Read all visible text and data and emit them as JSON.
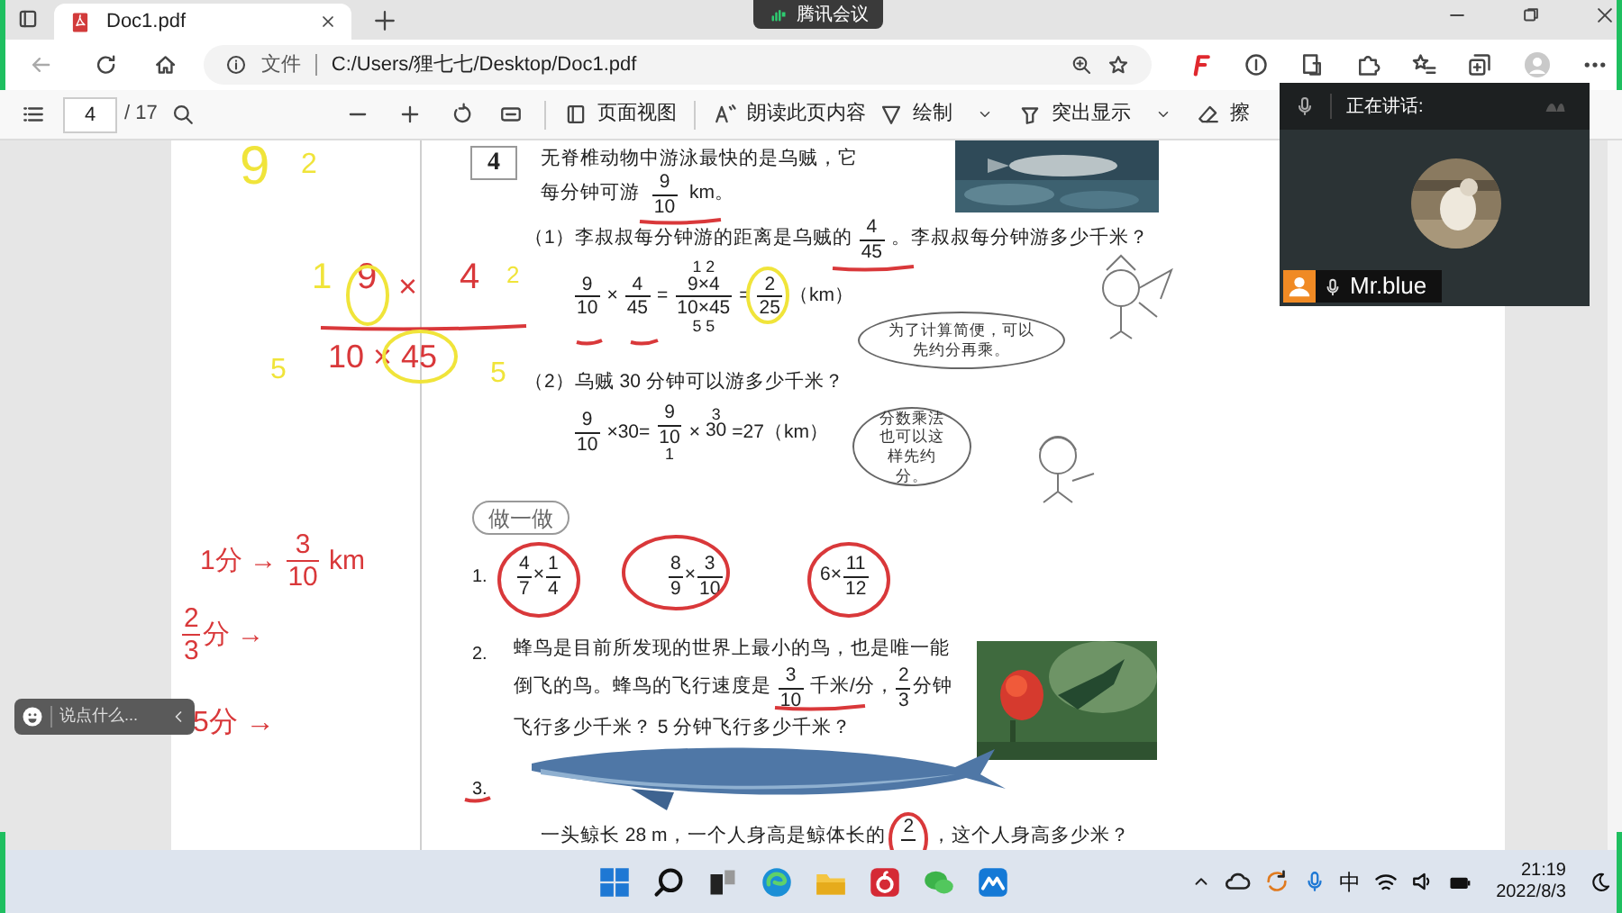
{
  "browser": {
    "tabs": [
      {
        "label": "Doc1.pdf",
        "selected": true
      }
    ],
    "meeting_badge": "腾讯会议",
    "address": {
      "scheme": "文件",
      "url": "C:/Users/狸七七/Desktop/Doc1.pdf"
    }
  },
  "pdf_toolbar": {
    "page": "4",
    "page_count": "/ 17",
    "buttons": [
      {
        "kind": "view",
        "label": "页面视图"
      },
      {
        "kind": "read",
        "label": "朗读此页内容"
      },
      {
        "kind": "draw",
        "label": "绘制",
        "menu": true
      },
      {
        "kind": "highlight",
        "label": "突出显示",
        "menu": true
      },
      {
        "kind": "erase",
        "label": "擦",
        "menu": false
      }
    ]
  },
  "page": {
    "problem_number": "4",
    "lines": [
      [
        "无脊椎动物中游泳最快的是乌贼，它"
      ],
      [
        "每分钟可游 ",
        {
          "kind": "frac",
          "num": "9",
          "den": "10"
        },
        " km。"
      ],
      [
        "（1）李叔叔每分钟游的距离是乌贼的",
        {
          "kind": "frac",
          "num": "4",
          "den": "45"
        },
        "。李叔叔每分钟游多少千米？"
      ],
      [
        {
          "kind": "frac",
          "num": "9",
          "den": "10"
        },
        "×",
        {
          "kind": "frac",
          "num": "4",
          "den": "45"
        },
        "=",
        {
          "kind": "frac",
          "above": "1 2",
          "num": "9×4",
          "den": "10×45",
          "below": "5 5"
        },
        "=",
        {
          "kind": "frac",
          "num": "2",
          "den": "25"
        },
        "（km）"
      ],
      [
        "（2）乌贼 30 分钟可以游多少千米？"
      ],
      [
        {
          "kind": "frac",
          "num": "9",
          "den": "10"
        },
        "×30=",
        {
          "kind": "frac",
          "num": "9",
          "den": "10",
          "below": "1"
        },
        "×",
        {
          "kind": "over",
          "above": "3",
          "text": "30"
        },
        "=27（km）"
      ]
    ],
    "bubbles": [
      "为了计算简便，可以先约分再乘。",
      "分数乘法也可以这样先约分。"
    ],
    "section_badge": "做一做",
    "exercise_1": {
      "number": "1.",
      "items": [
        [
          {
            "kind": "frac",
            "num": "4",
            "den": "7"
          },
          "×",
          {
            "kind": "frac",
            "num": "1",
            "den": "4"
          }
        ],
        [
          {
            "kind": "frac",
            "num": "8",
            "den": "9"
          },
          "×",
          {
            "kind": "frac",
            "num": "3",
            "den": "10"
          }
        ],
        [
          "6×",
          {
            "kind": "frac",
            "num": "11",
            "den": "12"
          }
        ]
      ]
    },
    "exercise_2": {
      "number": "2.",
      "lines": [
        [
          "蜂鸟是目前所发现的世界上最小的鸟，也是唯一能"
        ],
        [
          "倒飞的鸟。蜂鸟的飞行速度是 ",
          {
            "kind": "frac",
            "num": "3",
            "den": "10"
          },
          " 千米/分，",
          {
            "kind": "frac",
            "num": "2",
            "den": "3"
          },
          "分钟"
        ],
        [
          "飞行多少千米？ 5 分钟飞行多少千米？"
        ]
      ]
    },
    "exercise_3": {
      "number": "3.",
      "line": [
        "一头鲸长 28 m，一个人身高是鲸体长的",
        {
          "kind": "frac",
          "num": "2"
        },
        "，这个人身高多少米？"
      ]
    },
    "ink": [
      {
        "segments": [
          "9"
        ],
        "color": "#f0e43a"
      },
      {
        "segments": [
          "2"
        ],
        "color": "#f0e43a"
      },
      {
        "segments": [
          "1"
        ],
        "color": "#f0e43a"
      },
      {
        "segments": [
          "9"
        ],
        "color": "#d9383a"
      },
      {
        "segments": [
          "×"
        ],
        "color": "#d9383a"
      },
      {
        "segments": [
          "4"
        ],
        "color": "#d9383a"
      },
      {
        "segments": [
          "2"
        ],
        "color": "#f0e43a"
      },
      {
        "segments": [
          "5"
        ],
        "color": "#f0e43a"
      },
      {
        "segments": [
          "10 × 45"
        ],
        "color": "#d9383a"
      },
      {
        "segments": [
          "5"
        ],
        "color": "#f0e43a"
      },
      {
        "segments": [
          "1分 → ",
          {
            "kind": "frac",
            "num": "3",
            "den": "10"
          },
          " km"
        ],
        "color": "#d9383a"
      },
      {
        "segments": [
          {
            "kind": "frac",
            "num": "2",
            "den": "3"
          },
          "分 →"
        ],
        "color": "#d9383a"
      },
      {
        "segments": [
          "5分 →"
        ],
        "color": "#d9383a"
      }
    ],
    "ink_marks": [
      {
        "kind": "line",
        "color": "#d9383a"
      },
      {
        "kind": "circle",
        "color": "#f0e43a"
      },
      {
        "kind": "circle",
        "color": "#f0e43a"
      },
      {
        "kind": "circle",
        "color": "#f0e43a"
      },
      {
        "kind": "circle",
        "color": "#d9383a"
      },
      {
        "kind": "circle",
        "color": "#d9383a"
      },
      {
        "kind": "circle",
        "color": "#d9383a"
      },
      {
        "kind": "circle",
        "color": "#d9383a"
      },
      {
        "kind": "line",
        "color": "#d9383a"
      },
      {
        "kind": "line",
        "color": "#d9383a"
      },
      {
        "kind": "line",
        "color": "#d9383a"
      },
      {
        "kind": "line",
        "color": "#d9383a"
      },
      {
        "kind": "line",
        "color": "#d9383a"
      },
      {
        "kind": "line",
        "color": "#d9383a"
      }
    ]
  },
  "video": {
    "header": "正在讲话:",
    "speaker": "Mr.blue"
  },
  "chat": {
    "placeholder": "说点什么..."
  },
  "taskbar": {
    "ime": "中",
    "time": "21:19",
    "date": "2022/8/3"
  }
}
